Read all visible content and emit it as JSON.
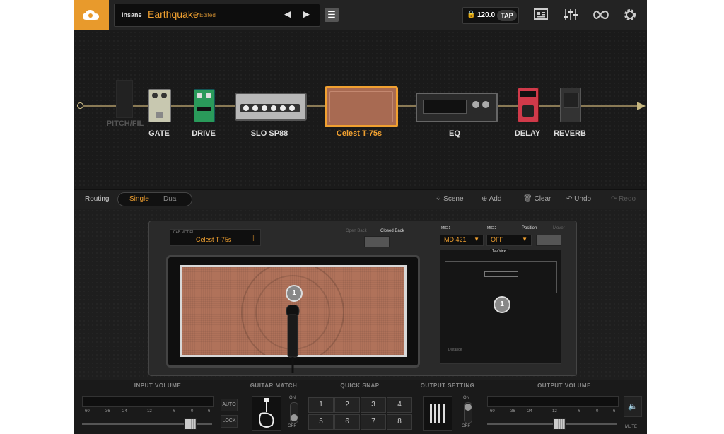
{
  "header": {
    "preset_bank": "Insane",
    "preset_name": "Earthquake",
    "preset_status": "*Edited",
    "tempo": "120.0",
    "tap_label": "TAP"
  },
  "chain": {
    "modules": [
      {
        "label": "PITCH/FIL"
      },
      {
        "label": "GATE"
      },
      {
        "label": "DRIVE"
      },
      {
        "label": "SLO SP88"
      },
      {
        "label": "Celest T-75s"
      },
      {
        "label": "EQ"
      },
      {
        "label": "DELAY"
      },
      {
        "label": "REVERB"
      }
    ]
  },
  "routing": {
    "label": "Routing",
    "single": "Single",
    "dual": "Dual",
    "scene": "Scene",
    "add": "Add",
    "clear": "Clear",
    "undo": "Undo",
    "redo": "Redo"
  },
  "cab": {
    "model_label": "CAB MODEL",
    "model_value": "Celest T-75s",
    "open_back": "Open Back",
    "closed_back": "Closed Back",
    "mic1_label": "MIC 1",
    "mic1_value": "MD 421",
    "mic2_label": "MIC 2",
    "mic2_value": "OFF",
    "position_label": "Position",
    "mover_label": "Mover",
    "top_view": "Top View",
    "distance": "Distance",
    "mic_badge": "1"
  },
  "bottom": {
    "input_volume": "INPUT VOLUME",
    "guitar_match": "GUITAR MATCH",
    "quick_snap": "QUICK SNAP",
    "output_setting": "OUTPUT SETTING",
    "output_volume": "OUTPUT VOLUME",
    "auto": "AUTO",
    "lock": "LOCK",
    "on": "ON",
    "off": "OFF",
    "mute": "MUTE",
    "meter_ticks": [
      "-60",
      "-36",
      "-24",
      "-12",
      "-6",
      "0",
      "6"
    ],
    "snap_buttons": [
      "1",
      "2",
      "3",
      "4",
      "5",
      "6",
      "7",
      "8"
    ]
  },
  "colors": {
    "accent": "#f0a030",
    "cloud_bg": "#e89a2c",
    "grill": "#b0725a"
  }
}
